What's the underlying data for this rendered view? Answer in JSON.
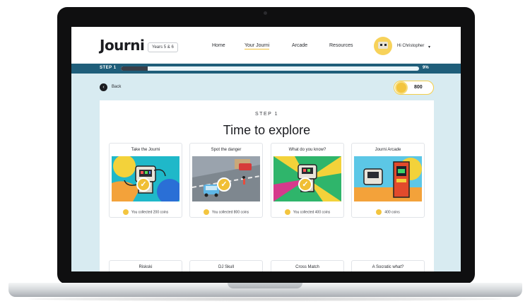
{
  "header": {
    "logo": "Journi",
    "years_badge": "Years 5 & 6",
    "nav": [
      "Home",
      "Your Journi",
      "Arcade",
      "Resources"
    ],
    "active_nav": "Your Journi",
    "user_greeting": "Hi Christopher",
    "dropdown_icon": "chevron-down-icon"
  },
  "progress": {
    "step_label": "STEP 1",
    "percent_label": "9%",
    "value_percent": 9
  },
  "back": {
    "label": "Back",
    "icon": "arrow-left-icon"
  },
  "coins": {
    "value": "800",
    "icon": "coin-icon"
  },
  "main": {
    "step_heading": "STEP 1",
    "title": "Time to explore"
  },
  "cards": [
    {
      "title": "Take the Journi",
      "reward": "You collected 200 coins",
      "completed": true
    },
    {
      "title": "Spot the danger",
      "reward": "You collected 800 coins",
      "completed": true
    },
    {
      "title": "What do you know?",
      "reward": "You collected 400 coins",
      "completed": true
    },
    {
      "title": "Journi Arcade",
      "reward": "400 coins",
      "completed": false
    }
  ],
  "cards_row2": [
    {
      "title": "Riskski"
    },
    {
      "title": "DJ Skull"
    },
    {
      "title": "Cross Match"
    },
    {
      "title": "A Socratic what?"
    }
  ],
  "colors": {
    "accent_yellow": "#f3c53f",
    "progress_bg": "#1f5e7a",
    "page_bg": "#d8ebf1"
  }
}
